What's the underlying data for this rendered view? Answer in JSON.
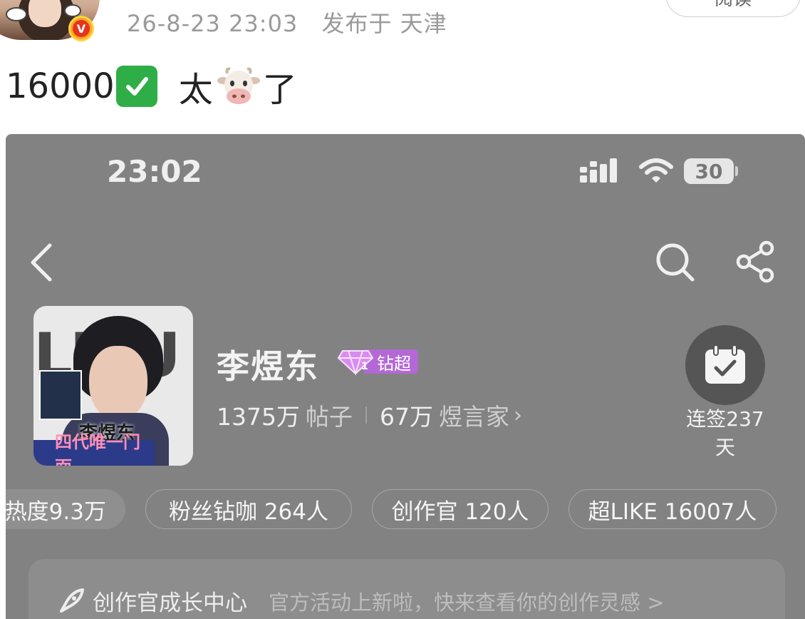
{
  "post": {
    "timestamp": "26-8-23 23:03",
    "location": "发布于 天津",
    "read_label": "阅读",
    "text_number": "16000",
    "text_word_1": "太",
    "text_word_2": "了",
    "emojis": [
      "check-mark-emoji",
      "cow-face-emoji"
    ]
  },
  "screenshot": {
    "status_time": "23:02",
    "battery_level": "30",
    "topic": {
      "name": "李煜东",
      "level_label": "钻超",
      "posts_count": "1375万",
      "posts_label": "帖子",
      "fans_count": "67万",
      "fans_label": "煜言家",
      "image_caption_name": "李煜东",
      "image_caption_sub": "四代唯一门面",
      "image_big_text": "LIYU"
    },
    "checkin": {
      "text_line1": "连签237",
      "text_line2": "天"
    },
    "chips": [
      "热度9.3万",
      "粉丝钻咖 264人",
      "创作官 120人",
      "超LIKE 16007人"
    ],
    "growth": {
      "title": "创作官成长中心",
      "description": "官方活动上新啦，快来查看你的创作灵感 >"
    }
  },
  "colors": {
    "overlay_gray": "#828282",
    "badge_purple": "#b368d6",
    "vip_orange": "#f5a623",
    "check_green": "#2fae48"
  }
}
